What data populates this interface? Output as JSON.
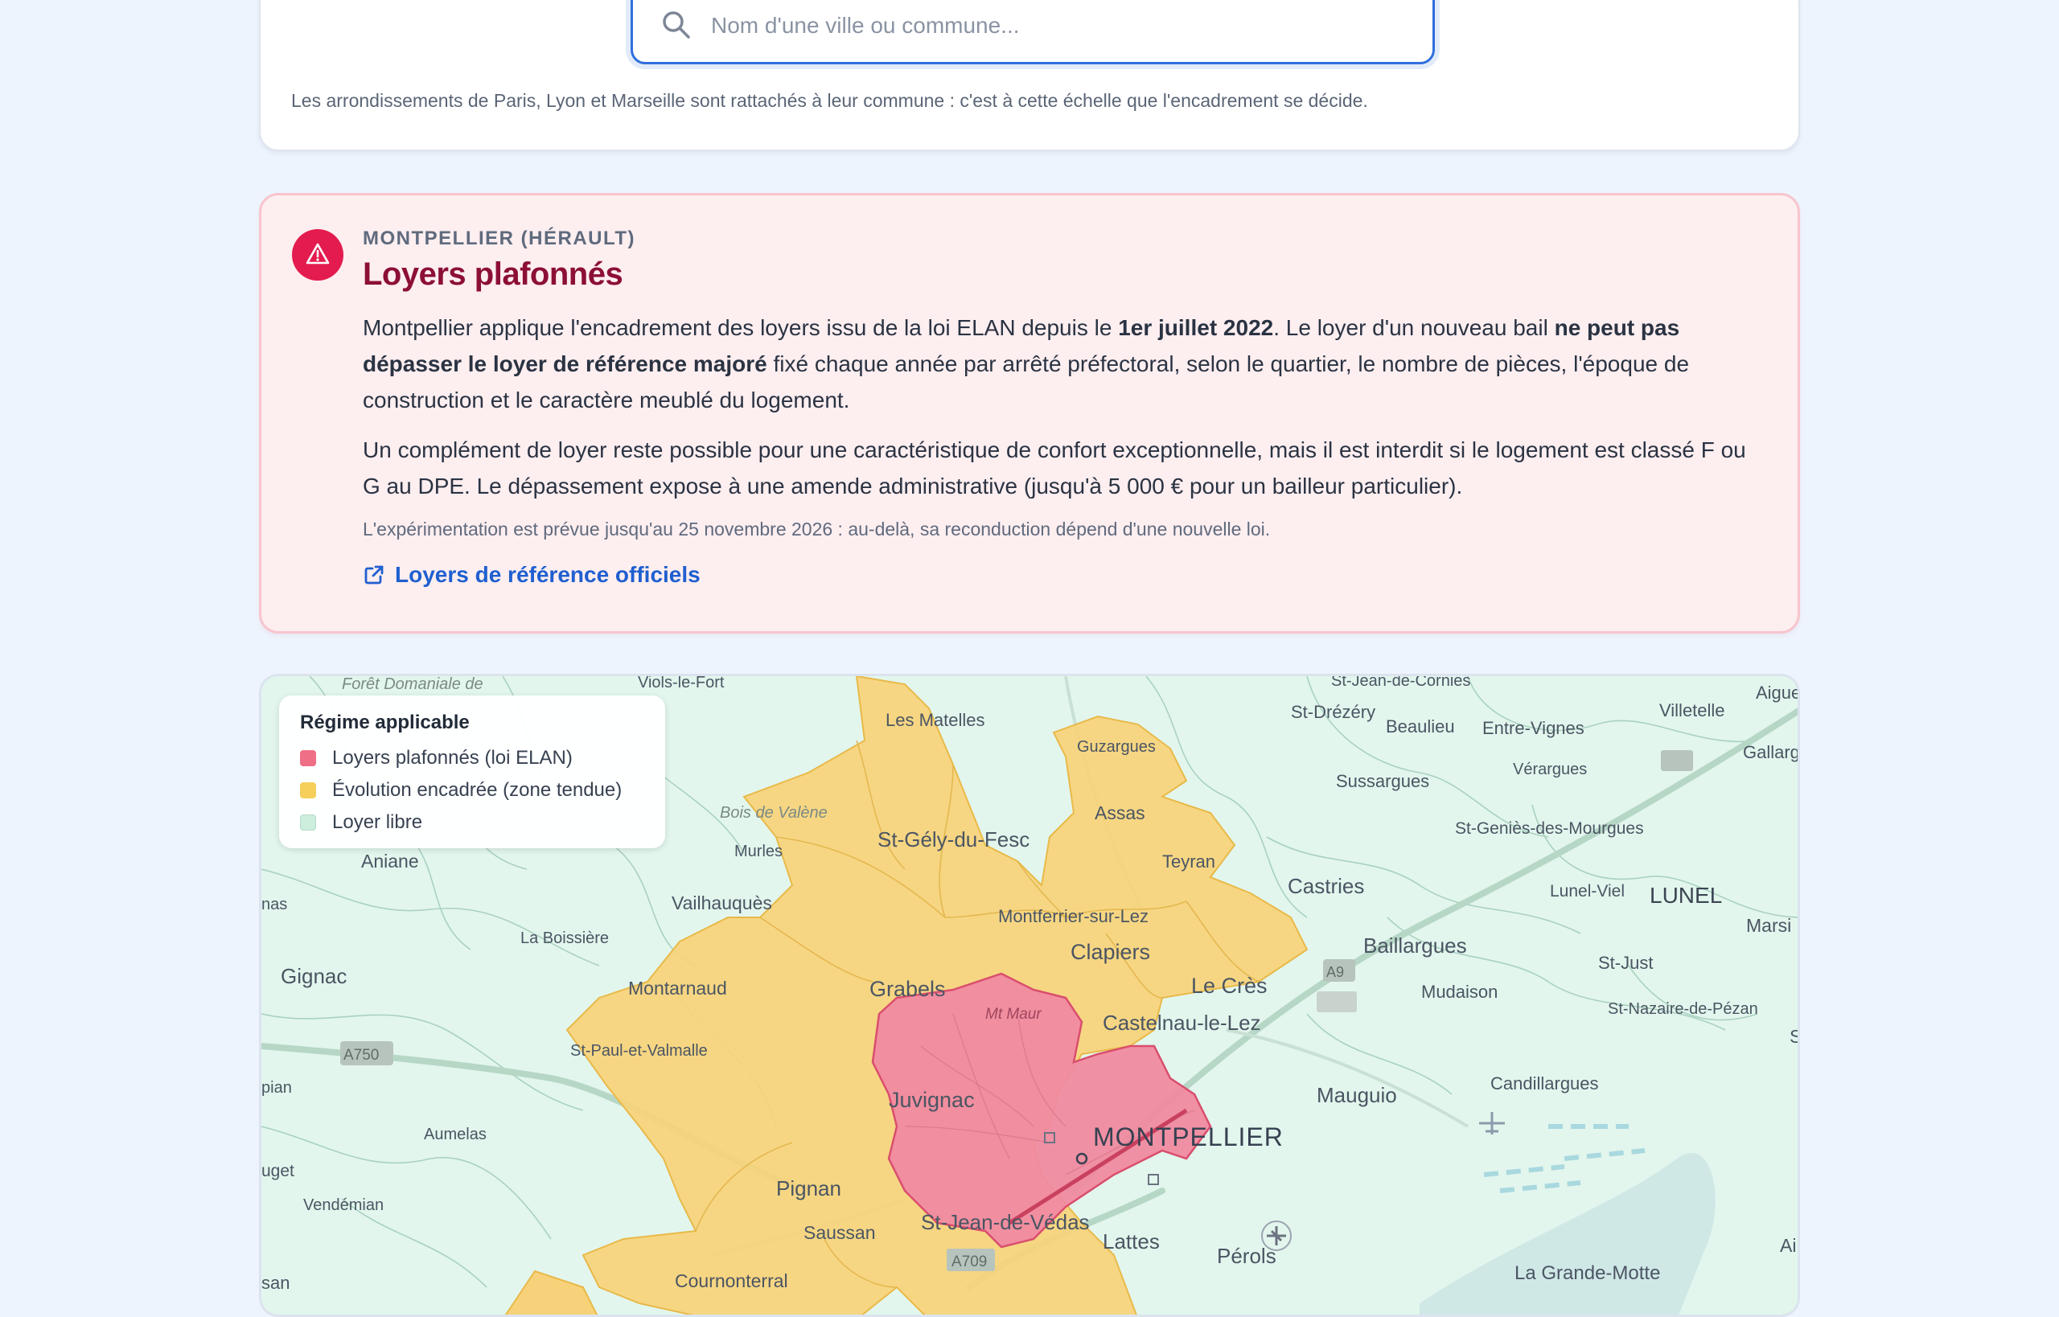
{
  "search": {
    "placeholder": "Nom d'une ville ou commune...",
    "value": "",
    "note": "Les arrondissements de Paris, Lyon et Marseille sont rattachés à leur commune : c'est à cette échelle que l'encadrement se décide."
  },
  "result": {
    "kicker": "MONTPELLIER (HÉRAULT)",
    "title": "Loyers plafonnés",
    "p1_a": "Montpellier applique l'encadrement des loyers issu de la loi ELAN depuis le ",
    "p1_b": "1er juillet 2022",
    "p1_c": ". Le loyer d'un nouveau bail ",
    "p1_d": "ne peut pas dépasser le loyer de référence majoré",
    "p1_e": " fixé chaque année par arrêté préfectoral, selon le quartier, le nombre de pièces, l'époque de construction et le caractère meublé du logement.",
    "p2": "Un complément de loyer reste possible pour une caractéristique de confort exceptionnelle, mais il est interdit si le logement est classé F ou G au DPE. Le dépassement expose à une amende administrative (jusqu'à 5 000 € pour un bailleur particulier).",
    "p3": "L'expérimentation est prévue jusqu'au 25 novembre 2026 : au-delà, sa reconduction dépend d'une nouvelle loi.",
    "link": "Loyers de référence officiels",
    "colors": {
      "accent": "#e31b4e",
      "title": "#8c0f36",
      "link": "#1f5fd0"
    }
  },
  "legend": {
    "title": "Régime applicable",
    "items": [
      {
        "label": "Loyers plafonnés (loi ELAN)",
        "color": "#ef6f86"
      },
      {
        "label": "Évolution encadrée (zone tendue)",
        "color": "#f5cf5a"
      },
      {
        "label": "Loyer libre",
        "color": "#cdeedd"
      }
    ]
  },
  "map": {
    "places": {
      "foret": "Forêt Domaniale de",
      "viols": "Viols-le-Fort",
      "stjeancornies": "St-Jean-de-Cornies",
      "aigues": "Aigue",
      "matelles": "Les Matelles",
      "guzargues": "Guzargues",
      "stdrezery": "St-Drézéry",
      "beaulieu": "Beaulieu",
      "entrevignes": "Entre-Vignes",
      "villetelle": "Villetelle",
      "gallargues": "Gallarg",
      "verargues": "Vérargues",
      "sussargues": "Sussargues",
      "boisvalene": "Bois de Valène",
      "assas": "Assas",
      "stgely": "St-Gély-du-Fesc",
      "stgenies": "St-Geniès-des-Mourgues",
      "murles": "Murles",
      "teyran": "Teyran",
      "aniane": "Aniane",
      "castries": "Castries",
      "lunelviel": "Lunel-Viel",
      "lunel": "LUNEL",
      "vailhauques": "Vailhauquès",
      "montferrier": "Montferrier-sur-Lez",
      "marsi": "Marsi",
      "nas": "nas",
      "laboissiere": "La Boissière",
      "baillargues": "Baillargues",
      "clapiers": "Clapiers",
      "stjust": "St-Just",
      "gignac": "Gignac",
      "montarnaud": "Montarnaud",
      "grabels": "Grabels",
      "lecres": "Le Crès",
      "mudaison": "Mudaison",
      "mtmaur": "Mt Maur",
      "stnazaire": "St-Nazaire-de-Pézan",
      "castelnau": "Castelnau-le-Lez",
      "a750": "A750",
      "stpaul": "St-Paul-et-Valmalle",
      "s": "S",
      "candillargues": "Candillargues",
      "pian": "pian",
      "mauguio": "Mauguio",
      "juvignac": "Juvignac",
      "montpellier": "MONTPELLIER",
      "aumelas": "Aumelas",
      "puget": "uget",
      "pignan": "Pignan",
      "vendemian": "Vendémian",
      "stjeanvedas": "St-Jean-de-Védas",
      "saussan": "Saussan",
      "lattes": "Lattes",
      "ai": "Ai",
      "perols": "Pérols",
      "a709": "A709",
      "cournonterral": "Cournonterral",
      "lagrandemotte": "La Grande-Motte",
      "san": "san",
      "a9": "A9"
    }
  }
}
